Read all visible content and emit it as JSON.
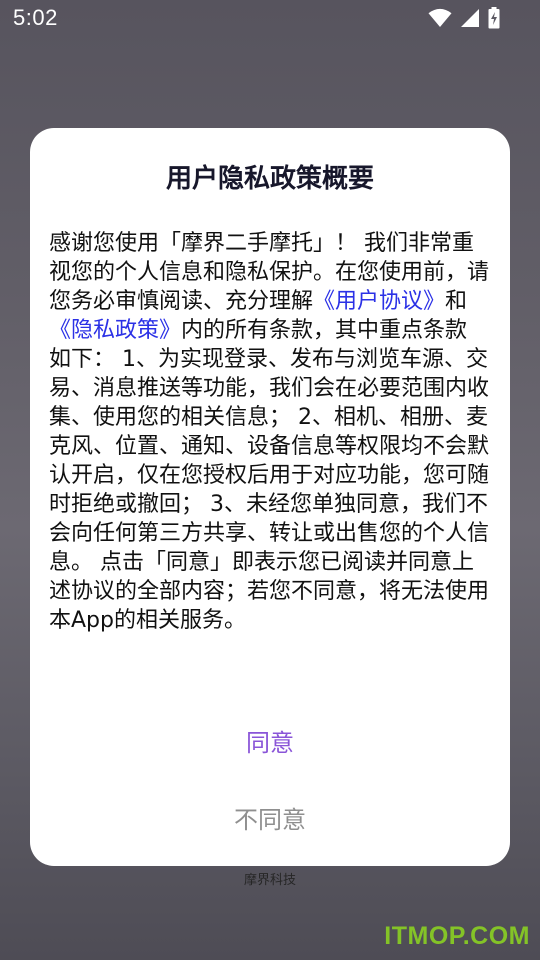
{
  "status_bar": {
    "time": "5:02",
    "icons": [
      "wifi-icon",
      "cellular-signal-icon",
      "battery-charging-icon"
    ]
  },
  "dialog": {
    "title": "用户隐私政策概要",
    "body": {
      "intro": "感谢您使用「摩界二手摩托」！ 我们非常重视您的个人信息和隐私保护。在您使用前，请您务必审慎阅读、充分理解",
      "user_agreement_link": "《用户协议》",
      "and": "和",
      "privacy_policy_link": "《隐私政策》",
      "rest": "内的所有条款，其中重点条款如下： 1、为实现登录、发布与浏览车源、交易、消息推送等功能，我们会在必要范围内收集、使用您的相关信息； 2、相机、相册、麦克风、位置、通知、设备信息等权限均不会默认开启，仅在您授权后用于对应功能，您可随时拒绝或撤回； 3、未经您单独同意，我们不会向任何第三方共享、转让或出售您的个人信息。 点击「同意」即表示您已阅读并同意上述协议的全部内容；若您不同意，将无法使用本App的相关服务。"
    },
    "agree_label": "同意",
    "disagree_label": "不同意"
  },
  "background": {
    "company_label": "摩界科技"
  },
  "watermark": "ITMOP.COM",
  "colors": {
    "link": "#2b31e6",
    "agree": "#8a55d8",
    "disagree": "#8f8f8f",
    "watermark": "#8ed81f"
  }
}
